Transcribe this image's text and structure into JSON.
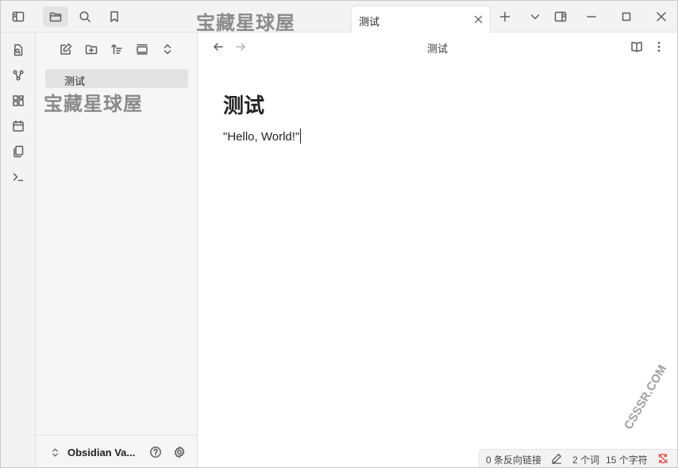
{
  "tab": {
    "title": "测试"
  },
  "watermark": {
    "text": "宝藏星球屋"
  },
  "site_watermark": {
    "text": "CSSSR.COM"
  },
  "sidebar": {
    "files": [
      {
        "name": "测试"
      }
    ],
    "vault_name": "Obsidian Va..."
  },
  "view": {
    "title": "测试"
  },
  "note": {
    "heading": "测试",
    "body": "\"Hello, World!\""
  },
  "status": {
    "backlinks": "0 条反向链接",
    "words": "2 个词",
    "chars": "15 个字符"
  },
  "colors": {
    "accent_sync_error": "#e0443a"
  },
  "icons": [
    "sidebar-toggle-icon",
    "folder-icon",
    "search-icon",
    "bookmark-icon",
    "new-tab-icon",
    "tab-list-chevron-icon",
    "right-sidebar-toggle-icon",
    "minimize-icon",
    "maximize-icon",
    "close-icon",
    "quick-switcher-icon",
    "graph-icon",
    "canvas-icon",
    "calendar-icon",
    "templates-icon",
    "terminal-icon",
    "new-note-icon",
    "new-folder-icon",
    "sort-icon",
    "collapse-view-icon",
    "expand-collapse-icon",
    "back-arrow-icon",
    "forward-arrow-icon",
    "reading-view-icon",
    "more-options-icon",
    "vault-switch-icon",
    "help-icon",
    "settings-icon",
    "edit-icon",
    "sync-status-icon"
  ]
}
